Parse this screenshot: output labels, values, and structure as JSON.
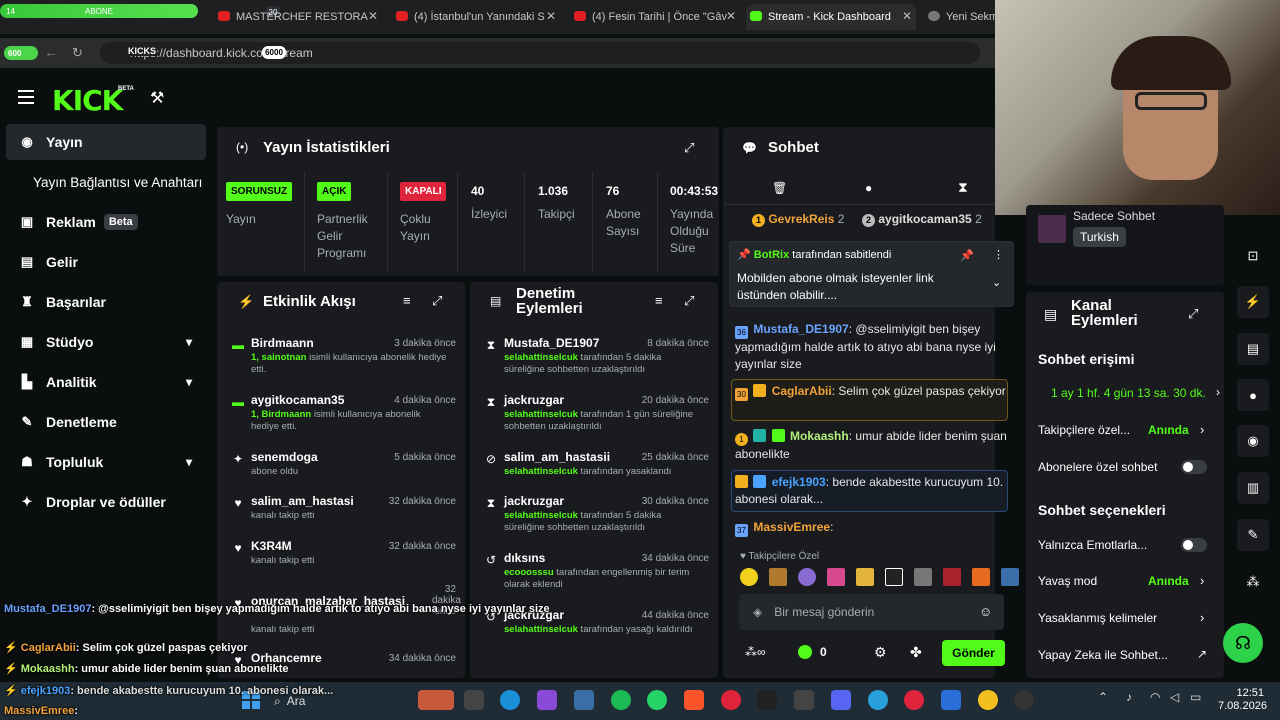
{
  "browser": {
    "green_bar_left": "14",
    "green_bar_label": "ABONE",
    "green_bar_right": "20",
    "tabs": [
      {
        "label": "MASTERCHEF RESTORA",
        "fav": "youtube-icon"
      },
      {
        "label": "(4) İstanbul'un Yanındaki S",
        "fav": "youtube-icon"
      },
      {
        "label": "(4) Fesin Tarihi | Önce \"Gâv",
        "fav": "youtube-icon"
      },
      {
        "label": "Stream - Kick Dashboard",
        "fav": "kick-icon"
      },
      {
        "label": "Yeni Sekme",
        "fav": "globe-icon"
      }
    ],
    "address": "https://dashboard.kick.com/stream",
    "addr_overlay_left": "600",
    "addr_overlay_mid": "KICKS",
    "addr_overlay_right": "6000"
  },
  "header": {
    "logo": "KICK",
    "beta": "BETA"
  },
  "sidebar": {
    "items": [
      {
        "label": "Yayın",
        "icon": "broadcast-icon"
      },
      {
        "label": "Yayın Bağlantısı ve Anahtarı"
      },
      {
        "label": "Reklam",
        "icon": "ad-icon",
        "badge": "Beta"
      },
      {
        "label": "Gelir",
        "icon": "bank-icon"
      },
      {
        "label": "Başarılar",
        "icon": "trophy-icon"
      },
      {
        "label": "Stüdyo",
        "icon": "studio-icon"
      },
      {
        "label": "Analitik",
        "icon": "analytics-icon"
      },
      {
        "label": "Denetleme",
        "icon": "wrench-icon"
      },
      {
        "label": "Topluluk",
        "icon": "community-icon"
      },
      {
        "label": "Droplar ve ödüller",
        "icon": "gift-icon"
      }
    ]
  },
  "stats": {
    "title": "Yayın İstatistikleri",
    "items": [
      {
        "pill": "SORUNSUZ",
        "label": "Yayın"
      },
      {
        "pill": "AÇIK",
        "label": "Partnerlik Gelir Programı"
      },
      {
        "pill": "KAPALI",
        "label": "Çoklu Yayın"
      },
      {
        "value": "40",
        "label": "İzleyici"
      },
      {
        "value": "1.036",
        "label": "Takipçi"
      },
      {
        "value": "76",
        "label": "Abone Sayısı"
      },
      {
        "value": "00:43:53",
        "label": "Yayında Olduğu Süre"
      }
    ]
  },
  "activity": {
    "title": "Etkinlik Akışı",
    "items": [
      {
        "name": "Birdmaann",
        "time": "3 dakika önce",
        "hl": "1, sainotnan",
        "desc": " isimli kullanıcıya abonelik hediye etti."
      },
      {
        "name": "aygitkocaman35",
        "time": "4 dakika önce",
        "hl": "1, Birdmaann",
        "desc": " isimli kullanıcıya abonelik hediye etti."
      },
      {
        "name": "senemdoga",
        "time": "5 dakika önce",
        "hl": "",
        "desc": "abone oldu"
      },
      {
        "name": "salim_am_hastasi",
        "time": "32 dakika önce",
        "hl": "",
        "desc": "kanalı takip etti"
      },
      {
        "name": "K3R4M",
        "time": "32 dakika önce",
        "hl": "",
        "desc": "kanalı takip etti"
      },
      {
        "name": "onurcan_malzahar_hastasi",
        "time": "32 dakika önce",
        "hl": "",
        "desc": "kanalı takip etti"
      },
      {
        "name": "Orhancemre",
        "time": "34 dakika önce",
        "hl": "",
        "desc": ""
      }
    ]
  },
  "moderation": {
    "title": "Denetim Eylemleri",
    "items": [
      {
        "name": "Mustafa_DE1907",
        "time": "8 dakika önce",
        "hl": "selahattinselcuk",
        "desc": " tarafından 5 dakika süreliğine sohbetten uzaklaştırıldı"
      },
      {
        "name": "jackruzgar",
        "time": "20 dakika önce",
        "hl": "selahattinselcuk",
        "desc": " tarafından 1 gün süreliğine sohbetten uzaklaştırıldı"
      },
      {
        "name": "salim_am_hastasii",
        "time": "25 dakika önce",
        "hl": "selahattinselcuk",
        "desc": " tarafından yasaklandı"
      },
      {
        "name": "jackruzgar",
        "time": "30 dakika önce",
        "hl": "selahattinselcuk",
        "desc": " tarafından 5 dakika süreliğine sohbetten uzaklaştırıldı"
      },
      {
        "name": "dıksıns",
        "time": "34 dakika önce",
        "hl": "ecooosssu",
        "desc": " tarafından engellenmiş bir terim olarak eklendi"
      },
      {
        "name": "jackruzgar",
        "time": "44 dakika önce",
        "hl": "selahattinselcuk",
        "desc": " tarafından yasağı kaldırıldı"
      }
    ]
  },
  "chat": {
    "title": "Sohbet",
    "top_users": [
      {
        "name": "GevrekReis",
        "count": "2"
      },
      {
        "name": "aygitkocaman35",
        "count": "2"
      }
    ],
    "pinned_by": "BotRix",
    "pinned_suffix": " tarafından sabitlendi",
    "pinned_text": "Mobilden abone olmak isteyenler link üstünden olabilir....",
    "messages": [
      {
        "badge": "36",
        "user": "Mustafa_DE1907",
        "color": "#6aa2ff",
        "text": "@sselimiyigit ben bişey yapmadığım halde artık to atıyo abi bana nyse iyi yayınlar size"
      },
      {
        "badge": "30",
        "user": "CaglarAbii",
        "color": "#f2a33a",
        "text": "Selim çok güzel paspas çekiyor"
      },
      {
        "badge": "1",
        "user": "Mokaashh",
        "color": "#b3f07a",
        "text": "umur abide lider benim şuan abonelikte"
      },
      {
        "badge": "",
        "user": "efejk1903",
        "color": "#4aa3ff",
        "text": "bende akabestte kurucuyum 10. abonesi olarak..."
      },
      {
        "badge": "37",
        "user": "MassivEmree",
        "color": "#f2a33a",
        "text": ""
      }
    ],
    "follower_only": "Takipçilere Özel",
    "input_placeholder": "Bir mesaj gönderin",
    "count": "0",
    "send": "Gönder"
  },
  "right": {
    "mode": "Sadece Sohbet",
    "lang": "Turkish",
    "title": "Kanal Eylemleri",
    "chat_access": "Sohbet erişimi",
    "follow_age": "1 ay 1 hf. 4 gün 13 sa. 30 dk.",
    "follower_special": "Takipçilere özel...",
    "follower_val": "Anında",
    "sub_only": "Abonelere özel sohbet",
    "chat_options": "Sohbet seçenekleri",
    "emote_only": "Yalnızca Emotlarla...",
    "slow_mode": "Yavaş mod",
    "slow_val": "Anında",
    "banned_words": "Yasaklanmış kelimeler",
    "ai_mod": "Yapay Zeka ile Sohbet..."
  },
  "overlay": [
    {
      "user": "Mustafa_DE1907",
      "text": ": @sselimiyigit ben bişey yapmadığım halde artık to atıyo abi bana nyse iyi yayınlar size"
    },
    {
      "user": "CaglarAbii",
      "text": ": Selim çok güzel paspas çekiyor"
    },
    {
      "user": "Mokaashh",
      "text": ": umur abide lider benim şuan abonelikte"
    },
    {
      "user": "efejk1903",
      "text": ": bende akabestte kurucuyum 10. abonesi olarak..."
    },
    {
      "user": "MassivEmree",
      "text": ":"
    }
  ],
  "taskbar": {
    "search": "Ara",
    "time": "12:51",
    "date": "7.08.2026"
  },
  "colors": {
    "accent": "#53fc18",
    "bg": "#0b0e0f",
    "panel": "#191b1f",
    "red": "#e0243b"
  }
}
